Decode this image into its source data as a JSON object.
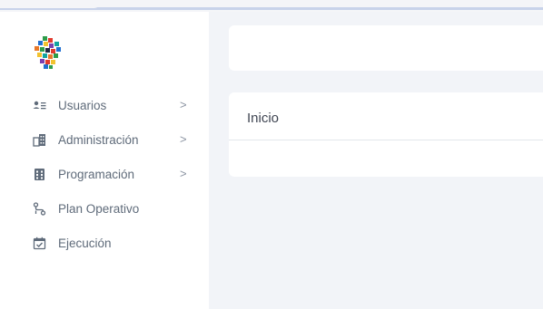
{
  "sidebar": {
    "logo_icon": "mosaic-logo",
    "items": [
      {
        "label": "Usuarios",
        "icon": "users-list-icon",
        "has_submenu": true,
        "chevron": ">"
      },
      {
        "label": "Administración",
        "icon": "building-icon",
        "has_submenu": true,
        "chevron": ">"
      },
      {
        "label": "Programación",
        "icon": "grid-calculator-icon",
        "has_submenu": true,
        "chevron": ">"
      },
      {
        "label": "Plan Operativo",
        "icon": "route-icon",
        "has_submenu": false
      },
      {
        "label": "Ejecución",
        "icon": "calendar-check-icon",
        "has_submenu": false
      }
    ]
  },
  "main": {
    "card_title": "Inicio"
  },
  "colors": {
    "background": "#f2f4f8",
    "sidebar": "#ffffff",
    "text": "#5f6b7a",
    "accent_strip": "#c8d3ea"
  }
}
